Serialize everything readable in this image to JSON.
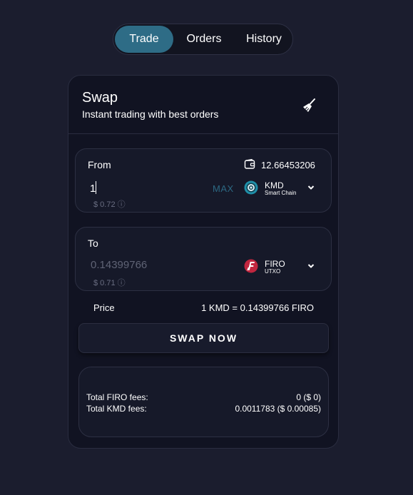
{
  "tabs": [
    {
      "label": "Trade",
      "active": true
    },
    {
      "label": "Orders",
      "active": false
    },
    {
      "label": "History",
      "active": false
    }
  ],
  "header": {
    "title": "Swap",
    "subtitle": "Instant trading with best orders",
    "icon": "broom-icon"
  },
  "from": {
    "label": "From",
    "balance": "12.66453206",
    "amount": "1",
    "usd": "$ 0.72 ⓘ",
    "max_label": "MAX",
    "coin": {
      "ticker": "KMD",
      "network": "Smart Chain",
      "color": "#1f8fa8"
    }
  },
  "to": {
    "label": "To",
    "amount": "0.14399766",
    "usd": "$ 0.71 ⓘ",
    "coin": {
      "ticker": "FIRO",
      "network": "UTXO",
      "color": "#c1263f"
    }
  },
  "price": {
    "label": "Price",
    "value": "1 KMD = 0.14399766 FIRO"
  },
  "swap_button": "SWAP NOW",
  "fees": [
    {
      "label": "Total FIRO fees:",
      "value": "0 ($ 0)"
    },
    {
      "label": "Total KMD fees:",
      "value": "0.0011783 ($ 0.00085)"
    }
  ],
  "colors": {
    "background": "#1b1d2e",
    "card": "#111322",
    "active_tab": "#2e6c86",
    "accent_max": "#2c6882"
  }
}
